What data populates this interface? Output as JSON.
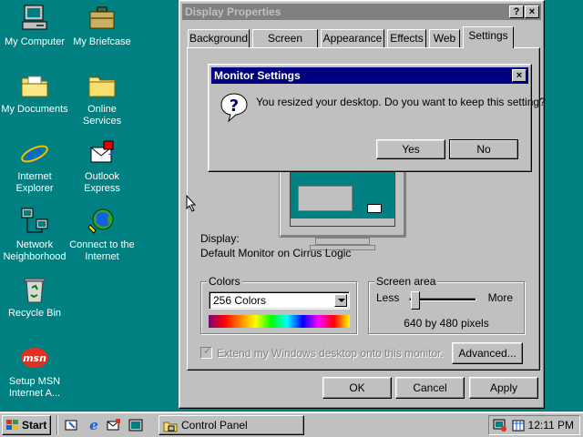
{
  "desktop": {
    "icons": [
      {
        "label": "My Computer"
      },
      {
        "label": "My Briefcase"
      },
      {
        "label": "My Documents"
      },
      {
        "label": "Online Services"
      },
      {
        "label": "Internet Explorer"
      },
      {
        "label": "Outlook Express"
      },
      {
        "label": "Network Neighborhood"
      },
      {
        "label": "Connect to the Internet"
      },
      {
        "label": "Recycle Bin"
      },
      {
        "label": "Setup MSN Internet A..."
      }
    ]
  },
  "display_properties": {
    "title": "Display Properties",
    "help_btn": "?",
    "close_btn": "×",
    "tabs": [
      "Background",
      "Screen Saver",
      "Appearance",
      "Effects",
      "Web",
      "Settings"
    ],
    "display_label": "Display:",
    "display_value": "Default Monitor on Cirrus Logic",
    "colors": {
      "title": "Colors",
      "selected": "256 Colors"
    },
    "screen_area": {
      "title": "Screen area",
      "less": "Less",
      "more": "More",
      "value": "640 by 480 pixels",
      "slider_position": 0
    },
    "extend_checkbox": "Extend my Windows desktop onto this monitor.",
    "advanced_btn": "Advanced...",
    "ok_btn": "OK",
    "cancel_btn": "Cancel",
    "apply_btn": "Apply"
  },
  "monitor_dialog": {
    "title": "Monitor Settings",
    "close_btn": "×",
    "icon": "question-icon",
    "message": "You resized your desktop.  Do you want to keep this setting?",
    "yes_btn": "Yes",
    "no_btn": "No"
  },
  "taskbar": {
    "start_label": "Start",
    "task_label": "Control Panel",
    "clock": "12:11 PM"
  },
  "colors": {
    "desktop": "#008080",
    "face": "#c0c0c0",
    "active_title": "#000080",
    "inactive_title": "#808080"
  }
}
